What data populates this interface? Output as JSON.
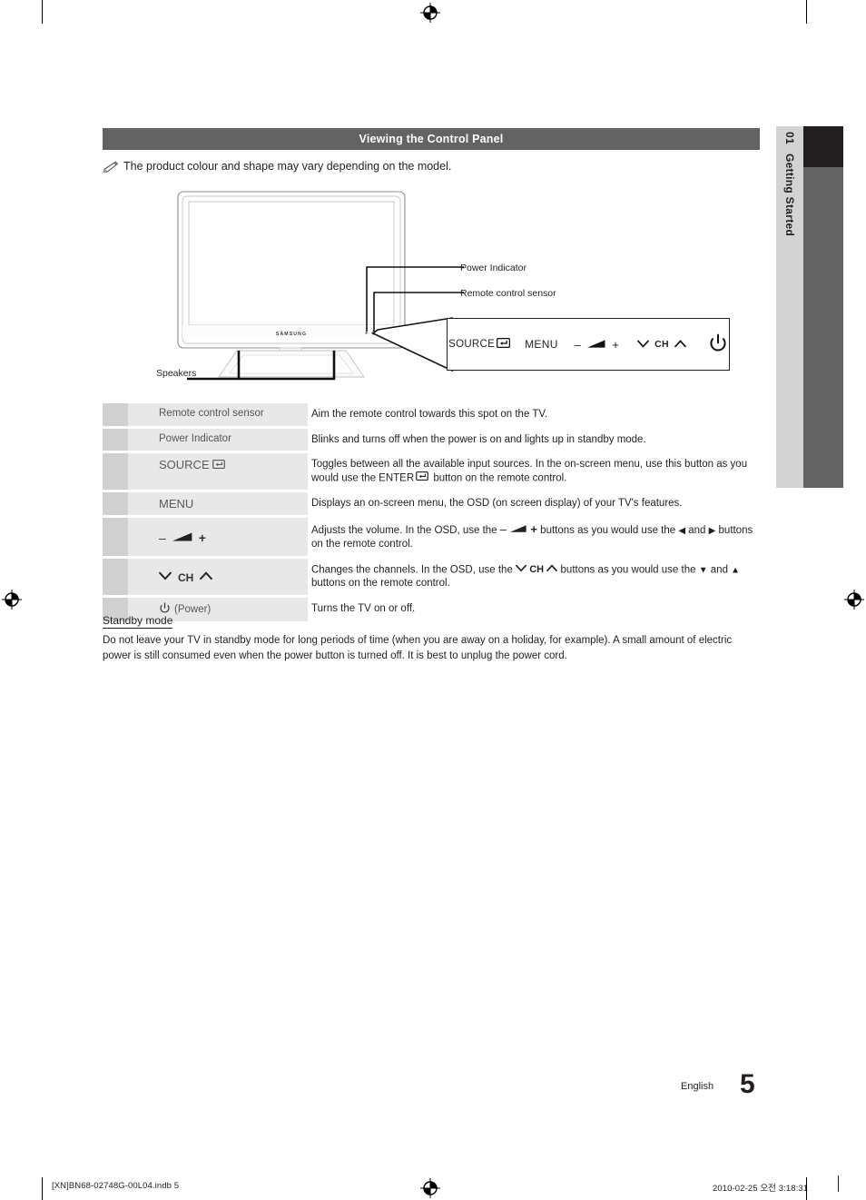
{
  "section": {
    "title": "Viewing the Control Panel",
    "note": "The product colour and shape may vary depending on the model.",
    "note_icon": "pencil-note-icon"
  },
  "chapter_tab": {
    "number": "01",
    "label": "Getting Started"
  },
  "figure": {
    "brand": "SAMSUNG",
    "callouts": [
      {
        "id": "power-indicator",
        "label": "Power Indicator"
      },
      {
        "id": "remote-control-sensor",
        "label": "Remote control sensor"
      },
      {
        "id": "speakers",
        "label": "Speakers"
      }
    ],
    "control_panel": {
      "source_label": "SOURCE",
      "source_icon": "enter-return-icon",
      "menu_label": "MENU",
      "volume_minus": "–",
      "volume_icon": "volume-wedge-icon",
      "volume_plus": "+",
      "ch_down_icon": "chevron-down-icon",
      "ch_label": "CH",
      "ch_up_icon": "chevron-up-icon",
      "power_icon": "power-icon"
    }
  },
  "table": {
    "rows": [
      {
        "label": "Remote control sensor",
        "label_style": "plain",
        "desc": "Aim the remote control towards this spot on the TV."
      },
      {
        "label": "Power Indicator",
        "label_style": "plain",
        "desc": "Blinks and turns off when the power is on and lights up in standby mode."
      },
      {
        "label": "SOURCE",
        "label_icon": "enter-return-icon",
        "label_style": "strong",
        "desc_part1": "Toggles between all the available input sources. In the on-screen menu, use this button as you would use the ",
        "desc_keyword": "ENTER",
        "desc_keyword_icon": "enter-return-icon",
        "desc_part2": " button on the remote control."
      },
      {
        "label": "MENU",
        "label_style": "strong",
        "desc": "Displays an on-screen menu, the OSD (on screen display) of your TV's features."
      },
      {
        "label_icons": "volume-control-icon",
        "label_style": "icons",
        "label_minus": "–",
        "label_plus": "+",
        "desc_part1": "Adjusts the volume. In the OSD, use the ",
        "desc_inline_icon": "volume-control-icon",
        "desc_part2": " buttons as you would use the ",
        "desc_left_arrow": "◀",
        "desc_and": " and ",
        "desc_right_arrow": "▶",
        "desc_part3": " buttons on the remote control."
      },
      {
        "label_icons": "channel-control-icon",
        "label_style": "icons",
        "label_ch": "CH",
        "desc_part1": "Changes the channels. In the OSD, use the ",
        "desc_inline_icon": "channel-control-icon",
        "desc_part2": " buttons as you would use the ",
        "desc_down_arrow": "▼",
        "desc_and": " and ",
        "desc_up_arrow": "▲",
        "desc_part3": " buttons on the remote control."
      },
      {
        "label": "(Power)",
        "label_icon": "power-icon",
        "label_style": "icon-text",
        "desc": "Turns the TV on or off."
      }
    ]
  },
  "standby": {
    "heading": "Standby mode",
    "body": "Do not leave your TV in standby mode for long periods of time (when you are away on a holiday, for example). A small amount of electric power is still consumed even when the power button is turned off. It is best to unplug the power cord."
  },
  "footer": {
    "language": "English",
    "page_number": "5",
    "file_name": "[XN]BN68-02748G-00L04.indb   5",
    "timestamp": "2010-02-25   오전 3:18:31"
  }
}
